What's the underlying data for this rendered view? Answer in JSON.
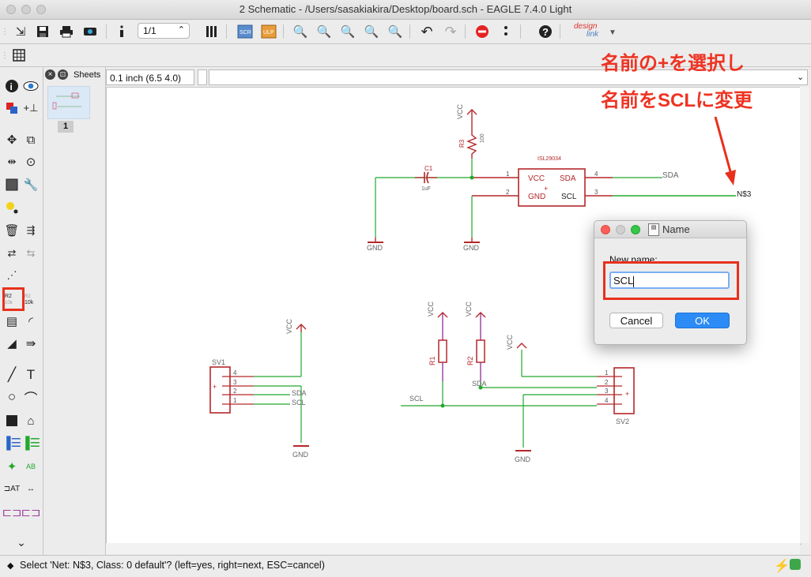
{
  "window": {
    "title": "2 Schematic - /Users/sasakiakira/Desktop/board.sch - EAGLE 7.4.0 Light"
  },
  "toolbar": {
    "page_selector": "1/1",
    "design_link_label": "design",
    "design_link_label2": "link"
  },
  "sheets_panel": {
    "title": "Sheets",
    "sheet_number": "1"
  },
  "grid": {
    "label": "0.1 inch (6.5 4.0)"
  },
  "command": {
    "value": ""
  },
  "schematic": {
    "part_ic": "ISL29034",
    "pin_vcc": "VCC",
    "pin_gnd": "GND",
    "pin_sda": "SDA",
    "pin_scl": "SCL",
    "net_n3": "N$3",
    "pin_num_1": "1",
    "pin_num_2": "2",
    "pin_num_3": "3",
    "pin_num_4": "4",
    "r3": "R3",
    "r3_value": "100",
    "c1": "C1",
    "c1_value": "1uF",
    "vcc": "VCC",
    "gnd": "GND",
    "sv1": "SV1",
    "sv2": "SV2",
    "r1": "R1",
    "r2": "R2",
    "sda": "SDA",
    "scl": "SCL",
    "plus": "+"
  },
  "dialog": {
    "title": "Name",
    "field_label": "New name:",
    "field_value": "SCL",
    "cancel_label": "Cancel",
    "ok_label": "OK"
  },
  "annotation": {
    "line1": "名前の+を選択し",
    "line2": "名前をSCLに変更"
  },
  "status": {
    "text": "Select 'Net: N$3, Class: 0 default'? (left=yes, right=next, ESC=cancel)"
  },
  "colors": {
    "wire": "#22a82d",
    "part": "#b5272a",
    "highlight": "#e8301c",
    "ok_button": "#2c8bf5"
  }
}
